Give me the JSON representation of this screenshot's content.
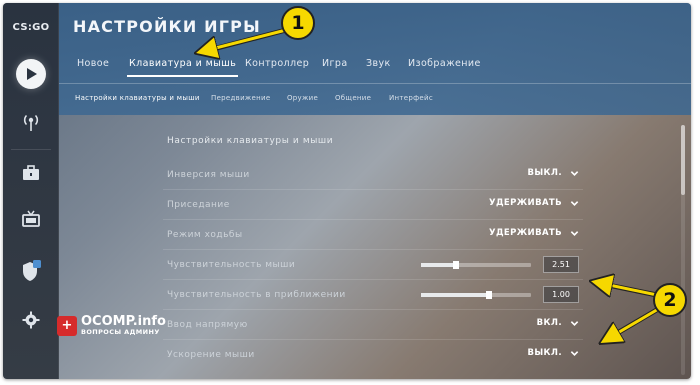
{
  "app": {
    "logo_text": "CS:GO",
    "title": "НАСТРОЙКИ ИГРЫ"
  },
  "sidebar": {
    "items": [
      {
        "icon": "play-icon"
      },
      {
        "icon": "broadcast-icon"
      },
      {
        "icon": "briefcase-icon"
      },
      {
        "icon": "tv-icon"
      },
      {
        "icon": "shield-icon"
      },
      {
        "icon": "gear-icon"
      }
    ]
  },
  "tabs": [
    {
      "label": "Новое"
    },
    {
      "label": "Клавиатура и мышь",
      "active": true
    },
    {
      "label": "Контроллер"
    },
    {
      "label": "Игра"
    },
    {
      "label": "Звук"
    },
    {
      "label": "Изображение"
    }
  ],
  "subtabs": [
    {
      "label": "Настройки клавиатуры и мыши",
      "active": true
    },
    {
      "label": "Передвижение"
    },
    {
      "label": "Оружие"
    },
    {
      "label": "Общение"
    },
    {
      "label": "Интерфейс"
    }
  ],
  "section": {
    "title": "Настройки клавиатуры и мыши"
  },
  "settings": [
    {
      "label": "Инверсия мыши",
      "value": "ВЫКЛ."
    },
    {
      "label": "Приседание",
      "value": "УДЕРЖИВАТЬ"
    },
    {
      "label": "Режим ходьбы",
      "value": "УДЕРЖИВАТЬ"
    },
    {
      "label": "Чувствительность мыши",
      "value": "2.51",
      "fill": 0.32
    },
    {
      "label": "Чувствительность в приближении",
      "value": "1.00",
      "fill": 0.62
    },
    {
      "label": "Ввод напрямую",
      "value": "ВКЛ."
    },
    {
      "label": "Ускорение мыши",
      "value": "ВЫКЛ."
    }
  ],
  "annotations": {
    "badge1": "1",
    "badge2": "2"
  },
  "watermark": {
    "name": "OCOMP.info",
    "subtitle": "ВОПРОСЫ АДМИНУ"
  },
  "colors": {
    "header": "#3b6894",
    "badge": "#f6d800",
    "sidebar": "#2a3340"
  }
}
